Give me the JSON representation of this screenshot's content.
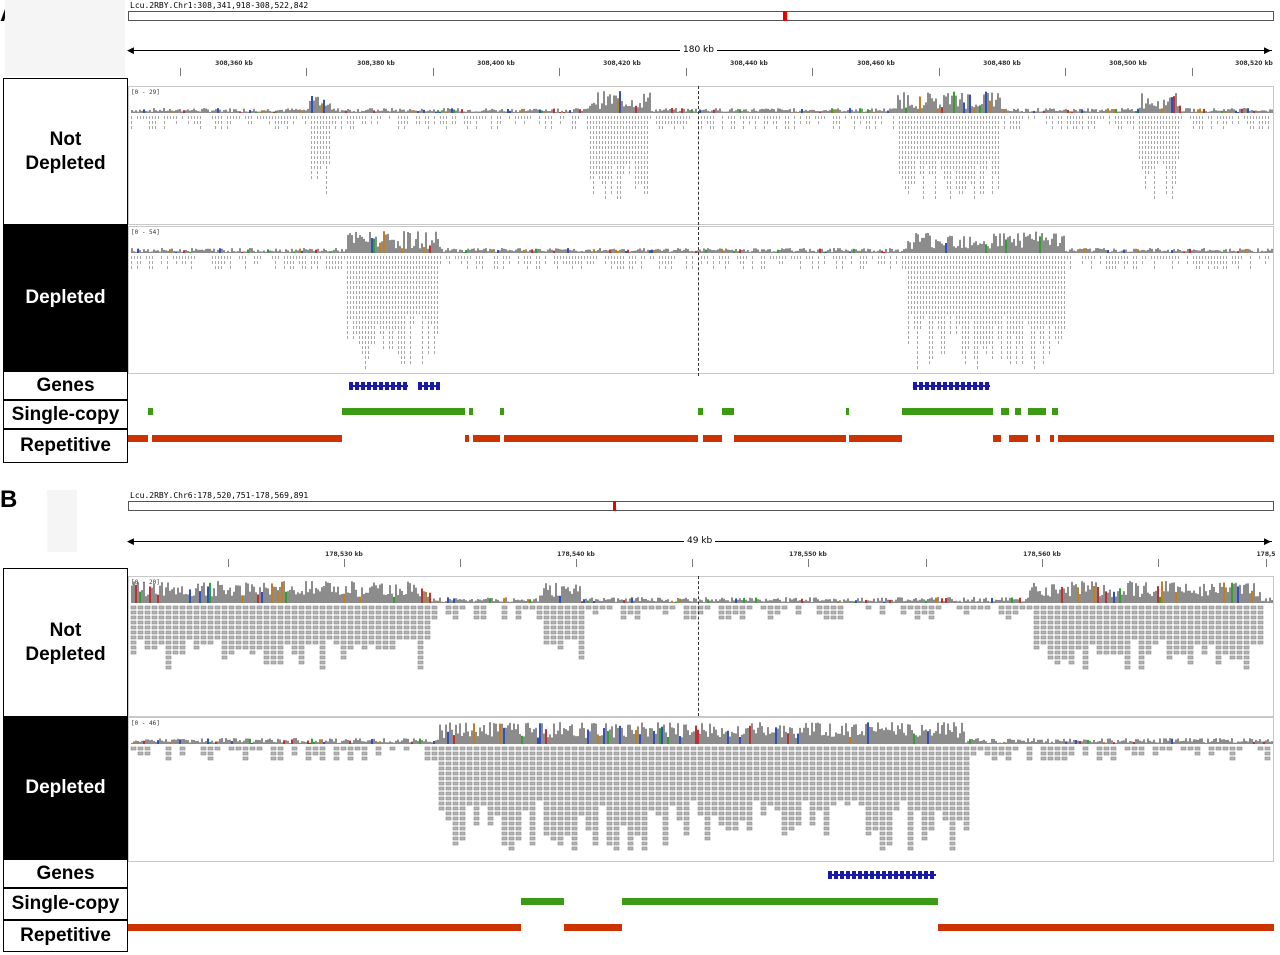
{
  "panels": [
    {
      "letter": "A",
      "locus": "Lcu.2RBY.Chr1:308,341,918-308,522,842",
      "span_label": "180 kb",
      "ticks": [
        "308,360 kb",
        "308,380 kb",
        "308,400 kb",
        "308,420 kb",
        "308,440 kb",
        "308,460 kb",
        "308,480 kb",
        "308,500 kb",
        "308,520 kb"
      ],
      "tracks": {
        "not_depleted": {
          "label_line1": "Not",
          "label_line2": "Depleted",
          "range": "[0 - 29]"
        },
        "depleted": {
          "label": "Depleted",
          "range": "[0 - 54]"
        },
        "genes": {
          "label": "Genes"
        },
        "single_copy": {
          "label": "Single-copy"
        },
        "repetitive": {
          "label": "Repetitive"
        }
      }
    },
    {
      "letter": "B",
      "locus": "Lcu.2RBY.Chr6:178,520,751-178,569,891",
      "span_label": "49 kb",
      "ticks": [
        "178,530 kb",
        "178,540 kb",
        "178,550 kb",
        "178,560 kb",
        "178,5"
      ],
      "tracks": {
        "not_depleted": {
          "label_line1": "Not",
          "label_line2": "Depleted",
          "range": "[0 - 20]"
        },
        "depleted": {
          "label": "Depleted",
          "range": "[0 - 46]"
        },
        "genes": {
          "label": "Genes"
        },
        "single_copy": {
          "label": "Single-copy"
        },
        "repetitive": {
          "label": "Repetitive"
        }
      }
    }
  ],
  "colors": {
    "gene": "#1a1aa8",
    "single_copy": "#3c9a14",
    "repetitive": "#cc3300",
    "read": "#9a9a9a",
    "coverage": "#8c8c8c",
    "ideogram_marker": "#e00000"
  }
}
